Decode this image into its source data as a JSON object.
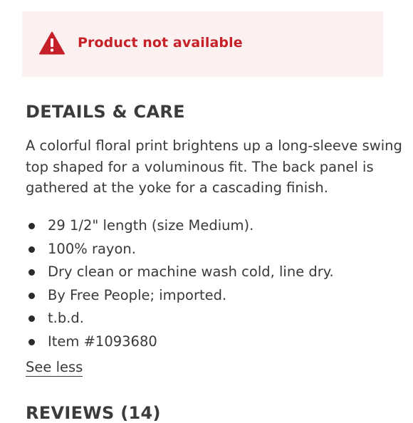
{
  "alert": {
    "icon": "warning-triangle-icon",
    "message": "Product not available",
    "color": "#c62128",
    "background": "#fbf1f1"
  },
  "details": {
    "title": "DETAILS & CARE",
    "description_lines": [
      "A colorful floral print brightens up a long-sleeve swing",
      "top shaped for a voluminous fit. The back panel is",
      "gathered at the yoke for a cascading finish."
    ],
    "bullets": [
      "29 1/2\" length (size Medium).",
      "100% rayon.",
      "Dry clean or machine wash cold, line dry.",
      "By Free People; imported.",
      "t.b.d.",
      "Item #1093680"
    ],
    "see_less_label": "See less"
  },
  "reviews": {
    "title": "REVIEWS (14)"
  }
}
